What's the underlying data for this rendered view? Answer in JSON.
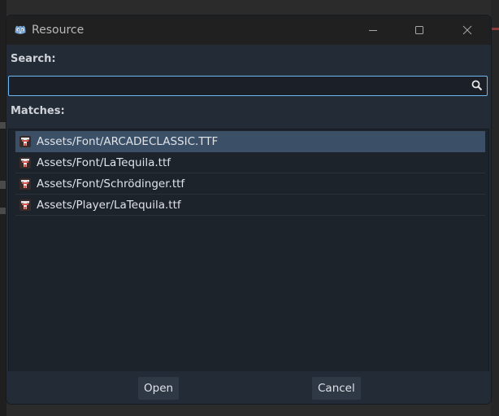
{
  "window": {
    "title": "Resource",
    "controls": [
      "minimize-icon",
      "maximize-icon",
      "close-icon"
    ]
  },
  "search": {
    "label": "Search:",
    "value": "",
    "placeholder": ""
  },
  "matches": {
    "label": "Matches:",
    "items": [
      {
        "path": "Assets/Font/ARCADECLASSIC.TTF",
        "icon": "font-file-icon",
        "selected": true
      },
      {
        "path": "Assets/Font/LaTequila.ttf",
        "icon": "font-file-icon",
        "selected": false
      },
      {
        "path": "Assets/Font/Schrödinger.ttf",
        "icon": "font-file-icon",
        "selected": false
      },
      {
        "path": "Assets/Player/LaTequila.ttf",
        "icon": "font-file-icon",
        "selected": false
      }
    ]
  },
  "buttons": {
    "open_label": "Open",
    "cancel_label": "Cancel"
  },
  "colors": {
    "accent": "#6fb8f0",
    "selection": "#3b4f66",
    "panel": "#222b36"
  }
}
